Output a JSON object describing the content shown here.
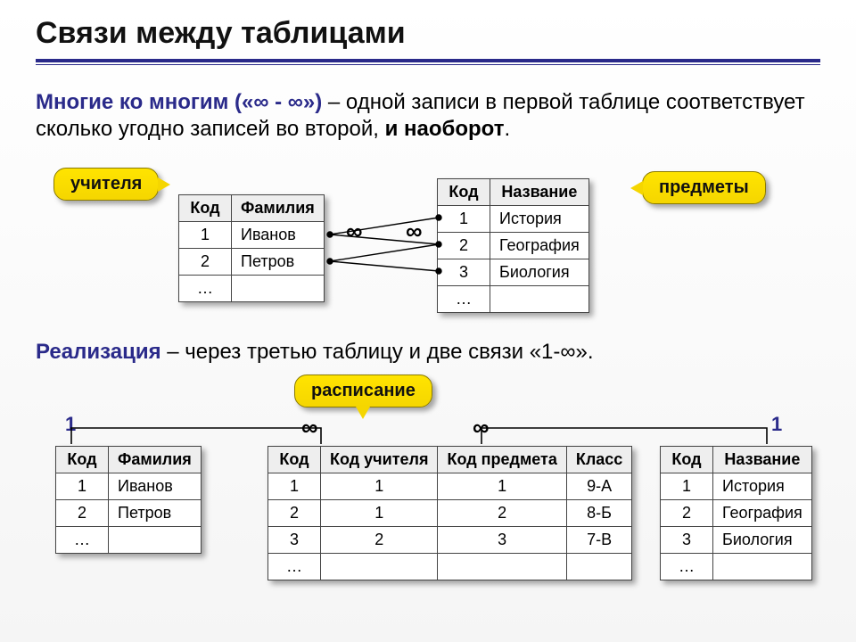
{
  "title": "Связи между таблицами",
  "para1": {
    "lead": "Многие ко многим («∞ - ∞»)",
    "rest": " – одной записи в первой таблице соответствует сколько угодно записей во второй, ",
    "tail": "и наоборот",
    "dot": "."
  },
  "para2": {
    "lead": "Реализация",
    "rest": " – через третью таблицу и две связи «1-∞»."
  },
  "callouts": {
    "teachers": "учителя",
    "subjects": "предметы",
    "schedule": "расписание"
  },
  "symbols": {
    "inf": "∞",
    "one": "1"
  },
  "tables": {
    "teachers": {
      "headers": [
        "Код",
        "Фамилия"
      ],
      "rows": [
        [
          "1",
          "Иванов"
        ],
        [
          "2",
          "Петров"
        ],
        [
          "…",
          ""
        ]
      ]
    },
    "subjects": {
      "headers": [
        "Код",
        "Название"
      ],
      "rows": [
        [
          "1",
          "История"
        ],
        [
          "2",
          "География"
        ],
        [
          "3",
          "Биология"
        ],
        [
          "…",
          ""
        ]
      ]
    },
    "schedule": {
      "headers": [
        "Код",
        "Код учителя",
        "Код предмета",
        "Класс"
      ],
      "rows": [
        [
          "1",
          "1",
          "1",
          "9-А"
        ],
        [
          "2",
          "1",
          "2",
          "8-Б"
        ],
        [
          "3",
          "2",
          "3",
          "7-В"
        ],
        [
          "…",
          "",
          "",
          ""
        ]
      ]
    }
  }
}
